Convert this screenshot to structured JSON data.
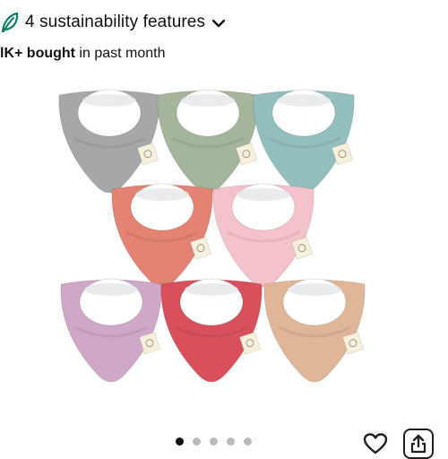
{
  "sustainability": {
    "label": "4 sustainability features",
    "leaf_icon": "leaf-icon",
    "expand_icon": "chevron-down-icon",
    "leaf_color": "#067d62"
  },
  "purchases": {
    "bold": "lK+ bought",
    "rest": " in past month"
  },
  "product_image": {
    "bib_colors": [
      "#a5a7a9",
      "#a5b59c",
      "#92bfbd",
      "#e48273",
      "#f4c2cb",
      "#cfa7c7",
      "#d9505d",
      "#dfb697"
    ]
  },
  "carousel": {
    "dot_count": 5,
    "active_index": 0
  },
  "actions": {
    "favorite_icon": "heart-outline-icon",
    "share_icon": "share-icon"
  }
}
